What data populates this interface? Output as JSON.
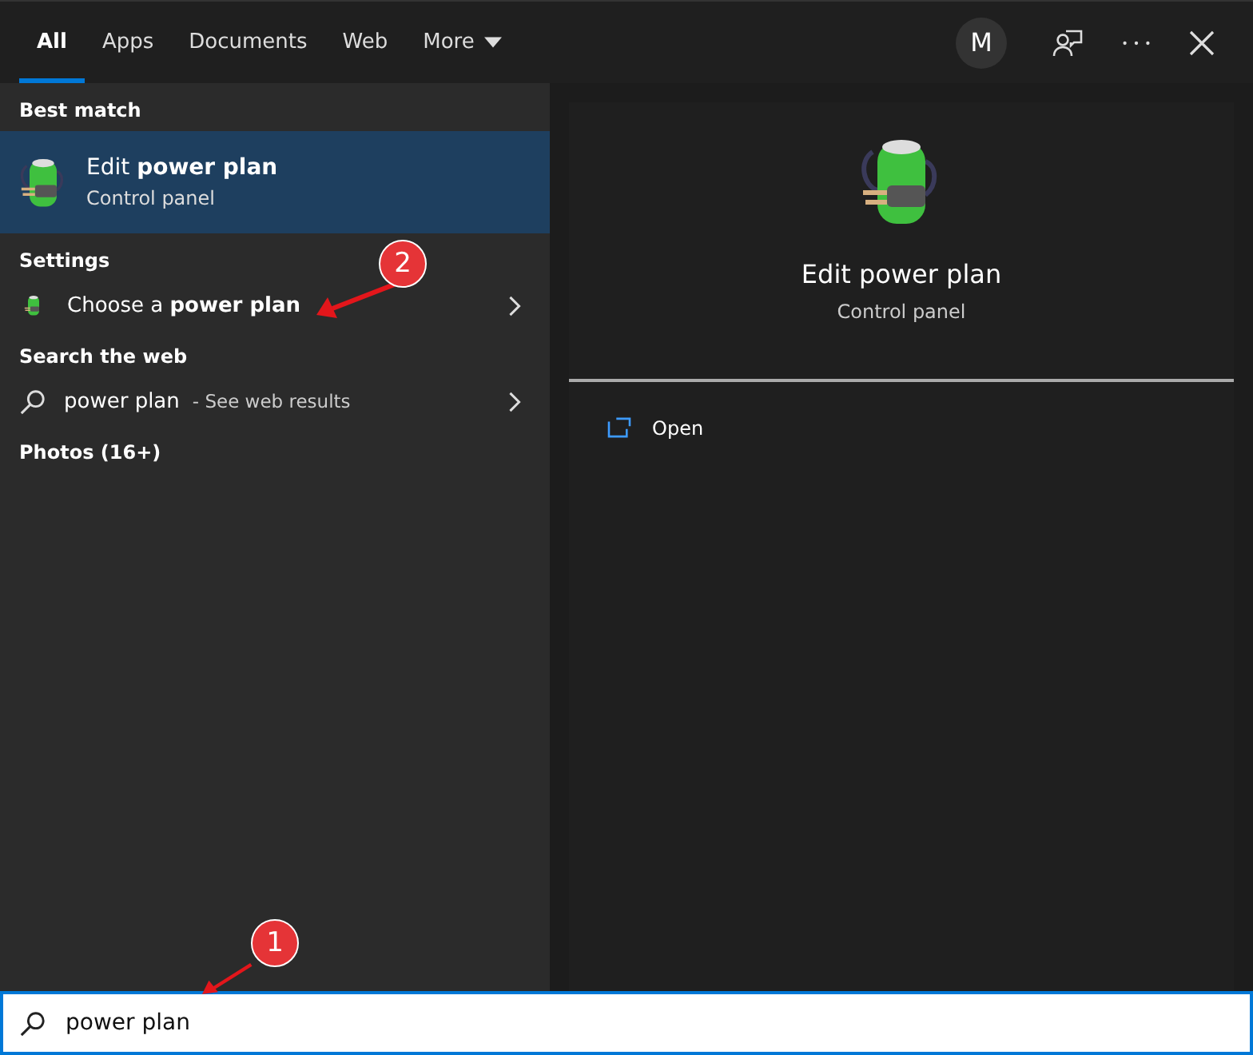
{
  "tabs": [
    {
      "label": "All",
      "selected": true,
      "kind": "tab"
    },
    {
      "label": "Apps",
      "selected": false,
      "kind": "tab"
    },
    {
      "label": "Documents",
      "selected": false,
      "kind": "tab"
    },
    {
      "label": "Web",
      "selected": false,
      "kind": "tab"
    },
    {
      "label": "More",
      "selected": false,
      "kind": "dropdown"
    }
  ],
  "avatar": "M",
  "results": [
    {
      "heading": "Best match",
      "items": [
        {
          "kind": "app",
          "title": "Edit **power plan**",
          "subtitle": "Control panel",
          "selected": true
        }
      ]
    },
    {
      "heading": "Settings",
      "items": [
        {
          "kind": "setting",
          "title": "Choose a **power plan**",
          "selected": false
        }
      ]
    },
    {
      "heading": "Search the web",
      "items": [
        {
          "kind": "web",
          "title": "power plan",
          "suffix": "- See web results",
          "selected": false
        }
      ]
    },
    {
      "heading": "Photos (16+)"
    }
  ],
  "preview": {
    "title": "Edit power plan",
    "subtitle": "Control panel",
    "actions": [
      {
        "label": "Open"
      }
    ]
  },
  "search": {
    "value": "power plan"
  },
  "annotations": [
    {
      "label": "1"
    },
    {
      "label": "2"
    }
  ]
}
